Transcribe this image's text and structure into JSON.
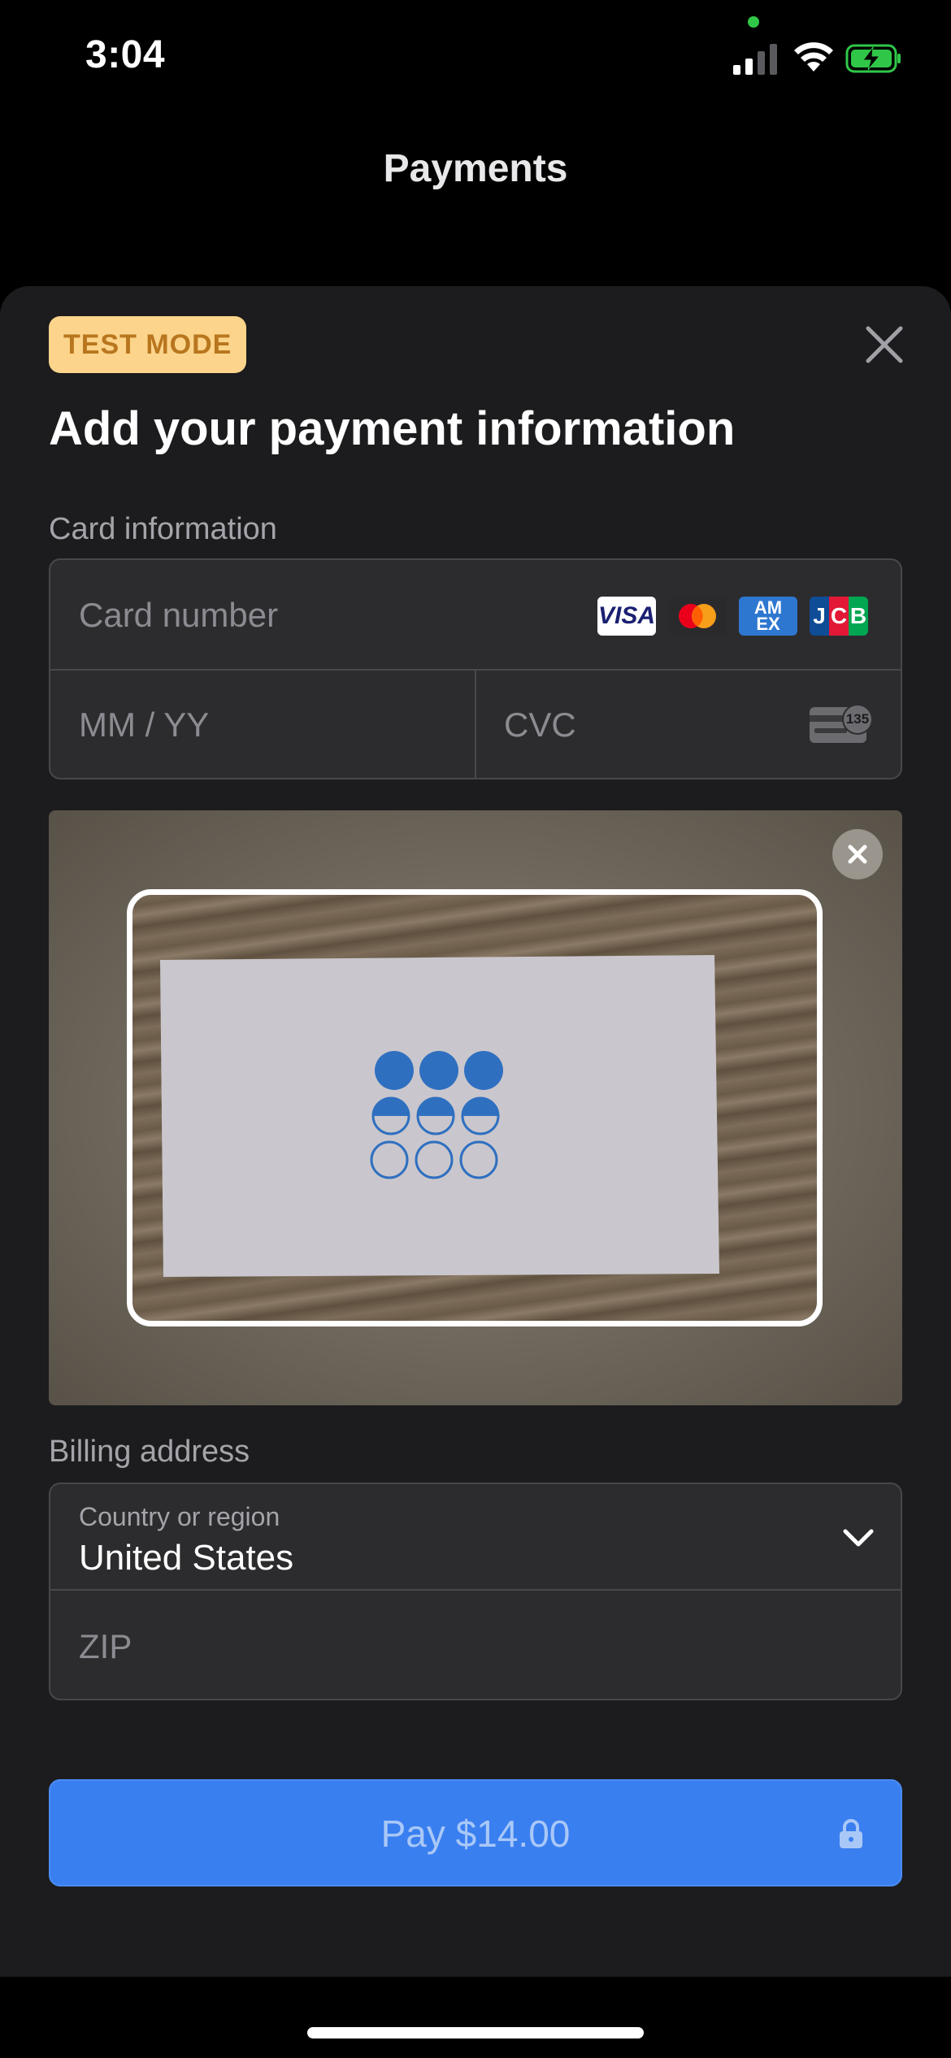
{
  "status_bar": {
    "time": "3:04"
  },
  "nav": {
    "title": "Payments"
  },
  "sheet": {
    "badge": "TEST MODE",
    "heading": "Add your payment information",
    "card_section_label": "Card information",
    "card_number_placeholder": "Card number",
    "expiry_placeholder": "MM / YY",
    "cvc_placeholder": "CVC",
    "cvc_hint_number": "135",
    "brands": [
      "VISA",
      "Mastercard",
      "AMEX",
      "JCB"
    ],
    "billing_section_label": "Billing address",
    "country_label": "Country or region",
    "country_value": "United States",
    "zip_placeholder": "ZIP",
    "pay_button_label": "Pay $14.00"
  },
  "colors": {
    "accent": "#3a7ff0",
    "badge_bg": "#fcd48b",
    "badge_text": "#b8761e",
    "card_logo_blue": "#2f6fc0"
  }
}
